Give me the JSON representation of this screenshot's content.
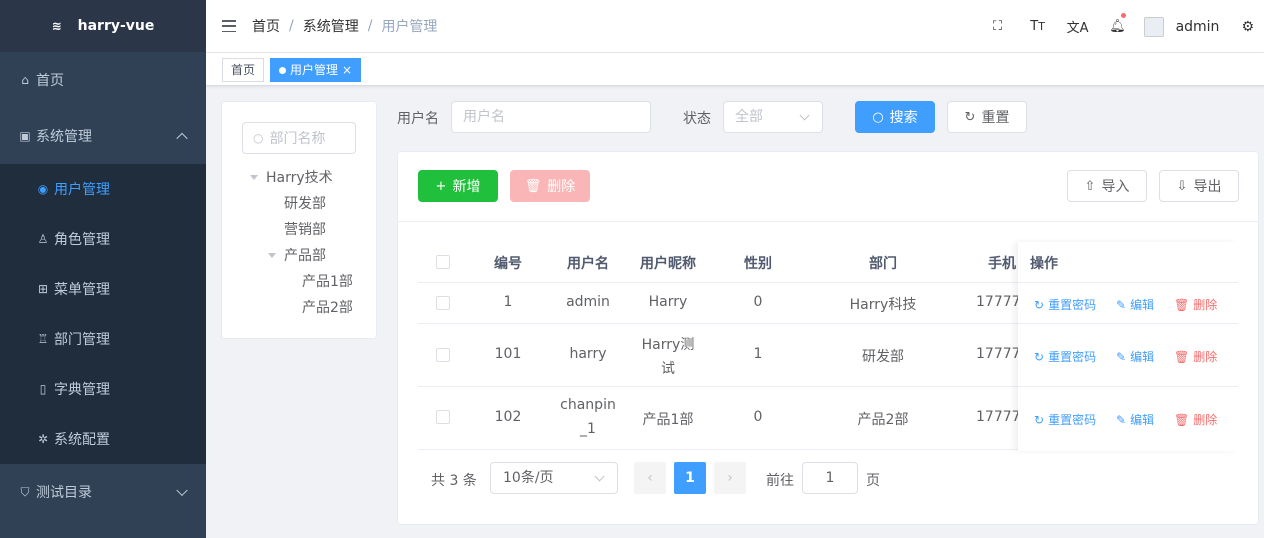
{
  "app": {
    "title": "harry-vue"
  },
  "sidebar": {
    "items": [
      {
        "label": "首页",
        "icon": "home-icon"
      },
      {
        "label": "系统管理",
        "icon": "system-icon",
        "expanded": true
      },
      {
        "label": "用户管理",
        "icon": "user-icon",
        "active": true
      },
      {
        "label": "角色管理",
        "icon": "role-icon"
      },
      {
        "label": "菜单管理",
        "icon": "menu-icon"
      },
      {
        "label": "部门管理",
        "icon": "tree-icon"
      },
      {
        "label": "字典管理",
        "icon": "dict-icon"
      },
      {
        "label": "系统配置",
        "icon": "gear-icon"
      },
      {
        "label": "测试目录",
        "icon": "shield-icon",
        "expanded": false
      }
    ]
  },
  "header": {
    "breadcrumb": [
      "首页",
      "系统管理",
      "用户管理"
    ],
    "username": "admin"
  },
  "tags": [
    {
      "label": "首页",
      "active": false
    },
    {
      "label": "用户管理",
      "active": true
    }
  ],
  "tree": {
    "search_placeholder": "部门名称",
    "nodes": [
      {
        "label": "Harry技术",
        "level": 0,
        "expandable": true
      },
      {
        "label": "研发部",
        "level": 1
      },
      {
        "label": "营销部",
        "level": 1
      },
      {
        "label": "产品部",
        "level": 1,
        "expandable": true
      },
      {
        "label": "产品1部",
        "level": 2
      },
      {
        "label": "产品2部",
        "level": 2
      }
    ]
  },
  "search": {
    "username_label": "用户名",
    "username_placeholder": "用户名",
    "status_label": "状态",
    "status_value": "全部",
    "search_button": "搜索",
    "reset_button": "重置"
  },
  "toolbar": {
    "add_button": "新增",
    "delete_button": "删除",
    "import_button": "导入",
    "export_button": "导出"
  },
  "table": {
    "columns": [
      "编号",
      "用户名",
      "用户昵称",
      "性别",
      "部门",
      "手机",
      "操作"
    ],
    "rows": [
      {
        "id": "1",
        "username": "admin",
        "nickname": "Harry",
        "nickname2": "",
        "username2": "",
        "gender": "0",
        "dept": "Harry科技",
        "phone": "17777"
      },
      {
        "id": "101",
        "username": "harry",
        "nickname": "Harry测",
        "nickname2": "试",
        "username2": "",
        "gender": "1",
        "dept": "研发部",
        "phone": "17777"
      },
      {
        "id": "102",
        "username": "chanpin",
        "username2": "_1",
        "nickname": "产品1部",
        "nickname2": "",
        "gender": "0",
        "dept": "产品2部",
        "phone": "17777"
      }
    ],
    "actions": {
      "reset_pwd": "重置密码",
      "edit": "编辑",
      "delete": "删除"
    }
  },
  "pagination": {
    "total_text": "共 3 条",
    "page_size": "10条/页",
    "current_page": "1",
    "goto_label": "前往",
    "goto_value": "1",
    "page_suffix": "页"
  },
  "colors": {
    "sidebar_bg": "#304156",
    "primary": "#409eff",
    "success": "#20c03d",
    "danger": "#f56c6c"
  }
}
